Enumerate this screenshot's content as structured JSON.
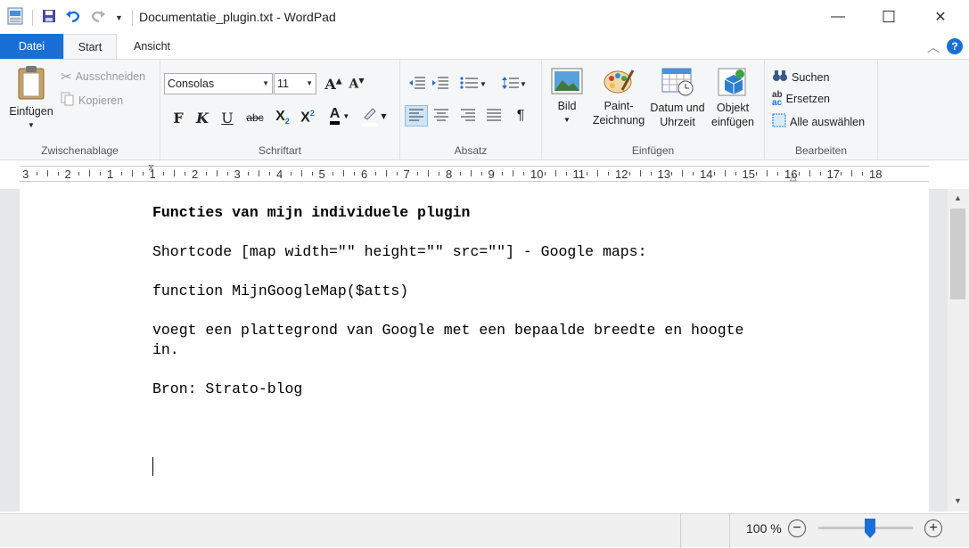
{
  "window": {
    "title": "Documentatie_plugin.txt - WordPad",
    "minimize_glyph": "—",
    "maximize_glyph": "☐",
    "close_glyph": "✕"
  },
  "quick_access": {
    "icons": [
      "app-icon",
      "save-icon",
      "undo-icon",
      "redo-icon",
      "customize-qat-icon"
    ]
  },
  "tabs": [
    {
      "label": "Datei"
    },
    {
      "label": "Start"
    },
    {
      "label": "Ansicht"
    }
  ],
  "ribbon": {
    "clipboard": {
      "paste": "Einfügen",
      "cut": "Ausschneiden",
      "copy": "Kopieren",
      "label": "Zwischenablage"
    },
    "font": {
      "family": "Consolas",
      "size": "11",
      "bold": "F",
      "italic": "K",
      "underline": "U",
      "strike": "abc",
      "label": "Schriftart"
    },
    "paragraph": {
      "label": "Absatz"
    },
    "insert": {
      "picture_line1": "Bild",
      "paint_line1": "Paint-",
      "paint_line2": "Zeichnung",
      "datetime_line1": "Datum und",
      "datetime_line2": "Uhrzeit",
      "object_line1": "Objekt",
      "object_line2": "einfügen",
      "label": "Einfügen"
    },
    "edit": {
      "find": "Suchen",
      "replace": "Ersetzen",
      "select_all": "Alle auswählen",
      "label": "Bearbeiten"
    }
  },
  "ruler": {
    "labels": [
      "3",
      "2",
      "1",
      "1",
      "2",
      "3",
      "4",
      "5",
      "6",
      "7",
      "8",
      "9",
      "10",
      "11",
      "12",
      "13",
      "14",
      "15",
      "16",
      "17",
      "18"
    ]
  },
  "document": {
    "lines": [
      "Functies van mijn individuele plugin",
      "Shortcode [map width=\"\" height=\"\" src=\"\"] - Google maps:",
      "function MijnGoogleMap($atts)",
      "voegt een plattegrond van Google met een bepaalde breedte en hoogte",
      "in.",
      "Bron: Strato-blog"
    ]
  },
  "status": {
    "zoom": "100 %",
    "zoom_level": 1.0
  },
  "colors": {
    "accent": "#1a6fd6",
    "ribbon_bg": "#f5f6f7",
    "zoom_thumb": "#1a6fd6"
  }
}
